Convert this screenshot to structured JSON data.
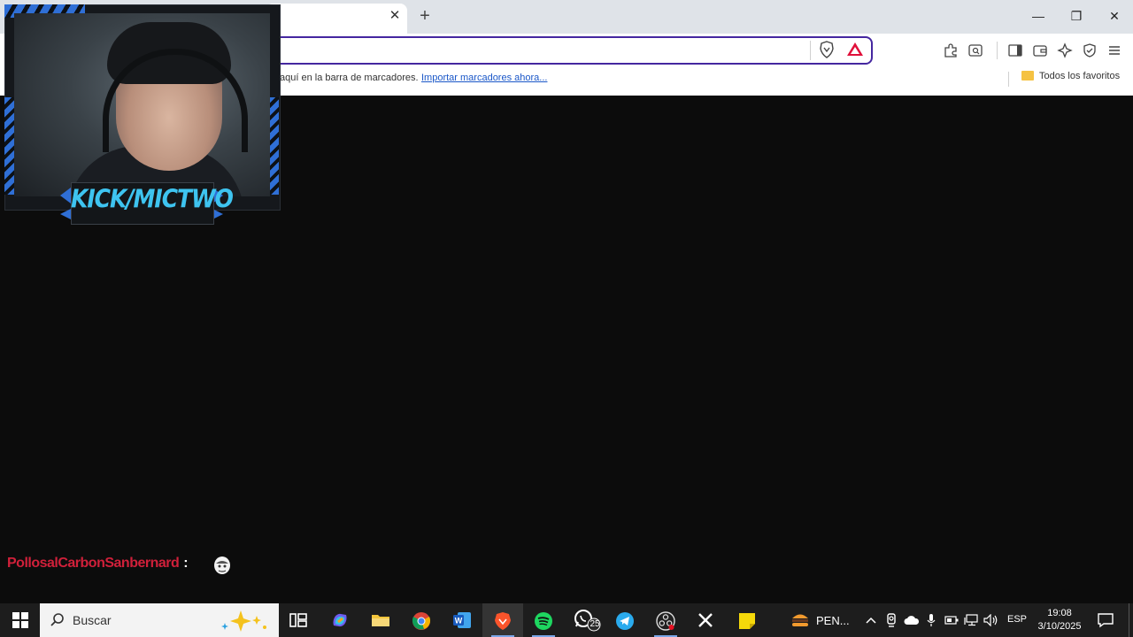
{
  "browser": {
    "tab_close": "✕",
    "new_tab": "+",
    "window_controls": {
      "minimize": "—",
      "restore": "❐",
      "close": "✕"
    },
    "bookmarks_bar": {
      "hint_text": "aquí en la barra de marcadores.",
      "import_link": "Importar marcadores ahora...",
      "all_bookmarks": "Todos los favoritos"
    },
    "toolbar_icons": [
      "extensions-icon",
      "search-in-page-icon",
      "sidebar-icon",
      "wallet-icon",
      "leo-ai-icon",
      "vpn-shield-icon",
      "menu-icon"
    ]
  },
  "stream_overlay": {
    "channel_label": "KICK/MICTWO",
    "accent_color": "#2f6fd6",
    "label_color": "#3ec4f0"
  },
  "chat": {
    "username": "PollosalCarbonSanbernard",
    "separator": ":",
    "username_color": "#d0203a"
  },
  "taskbar": {
    "search_placeholder": "Buscar",
    "apps": [
      "task-view",
      "copilot",
      "file-explorer",
      "chrome",
      "word",
      "brave",
      "spotify",
      "whatsapp",
      "telegram",
      "obs",
      "x",
      "sticky-notes"
    ],
    "whatsapp_badge": "25",
    "pending_label": "PEN...",
    "language": "ESP",
    "time": "19:08",
    "date": "3/10/2025"
  }
}
